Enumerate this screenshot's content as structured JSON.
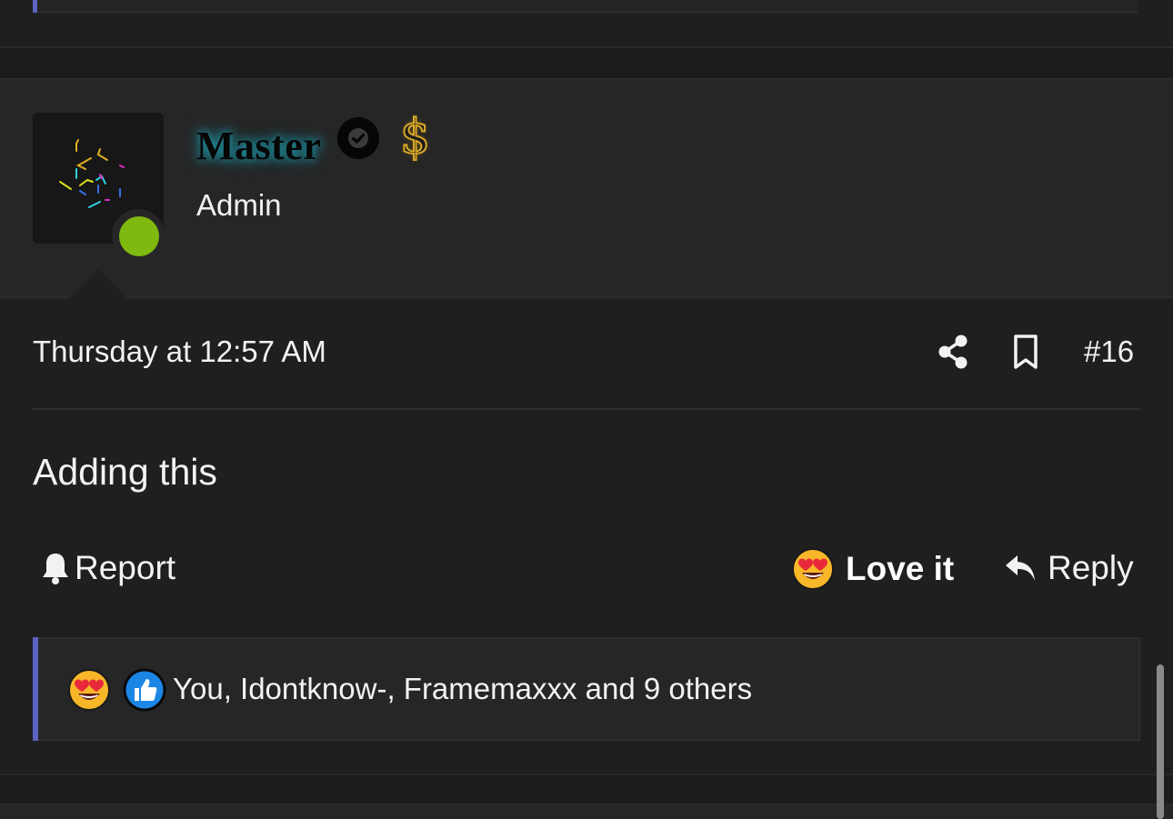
{
  "post": {
    "author": {
      "username": "Master",
      "role": "Admin",
      "status": "online",
      "verified": true,
      "badge_icon": "dollar-icon"
    },
    "date": "Thursday at 12:57 AM",
    "number": "#16",
    "body": "Adding this",
    "actions": {
      "report_label": "Report",
      "love_label": "Love it",
      "reply_label": "Reply"
    },
    "reactions": {
      "icons": [
        "heart-eyes-emoji",
        "thumbs-up-icon"
      ],
      "summary": "You, Idontknow-, Framemaxxx and 9 others"
    }
  },
  "colors": {
    "background": "#1f1f1f",
    "panel": "#262626",
    "accent_bar": "#5a63c0",
    "online": "#7fb80e",
    "username_glow": "#1fa6b8",
    "badge_gold": "#d8a928"
  }
}
